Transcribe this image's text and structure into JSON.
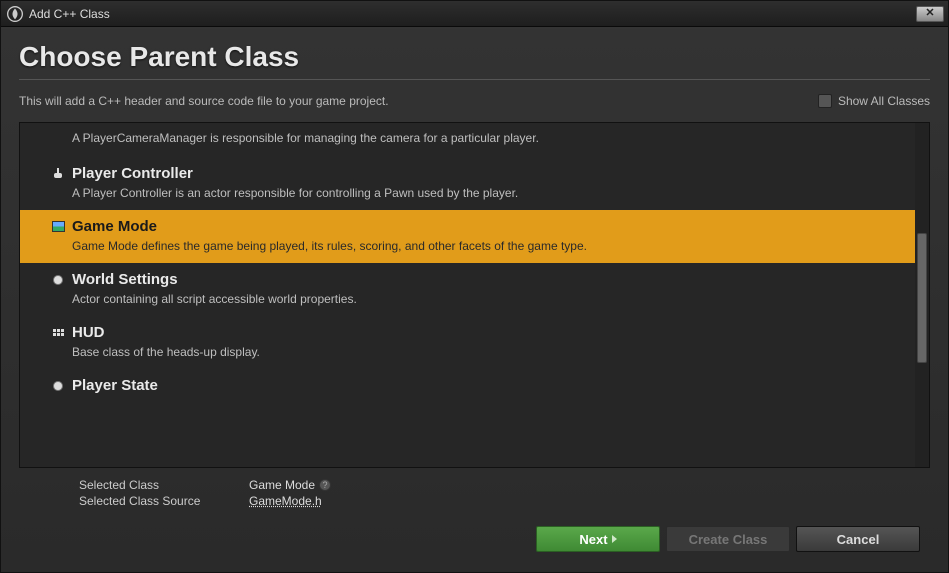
{
  "window": {
    "title": "Add C++ Class"
  },
  "header": {
    "page_title": "Choose Parent Class",
    "subtitle": "This will add a C++ header and source code file to your game project.",
    "show_all_label": "Show All Classes"
  },
  "list": {
    "partial_desc": "A PlayerCameraManager is responsible for managing the camera for a particular player.",
    "items": [
      {
        "title": "Player Controller",
        "desc": "A Player Controller is an actor responsible for controlling a Pawn used by the player.",
        "selected": false
      },
      {
        "title": "Game Mode",
        "desc": "Game Mode defines the game being played, its rules, scoring, and other facets of the game type.",
        "selected": true
      },
      {
        "title": "World Settings",
        "desc": "Actor containing all script accessible world properties.",
        "selected": false
      },
      {
        "title": "HUD",
        "desc": "Base class of the heads-up display.",
        "selected": false
      },
      {
        "title": "Player State",
        "desc": "",
        "selected": false
      }
    ]
  },
  "footer": {
    "selected_class_label": "Selected Class",
    "selected_class_value": "Game Mode",
    "selected_source_label": "Selected Class Source",
    "selected_source_value": "GameMode.h",
    "next_label": "Next",
    "create_label": "Create Class",
    "cancel_label": "Cancel"
  }
}
